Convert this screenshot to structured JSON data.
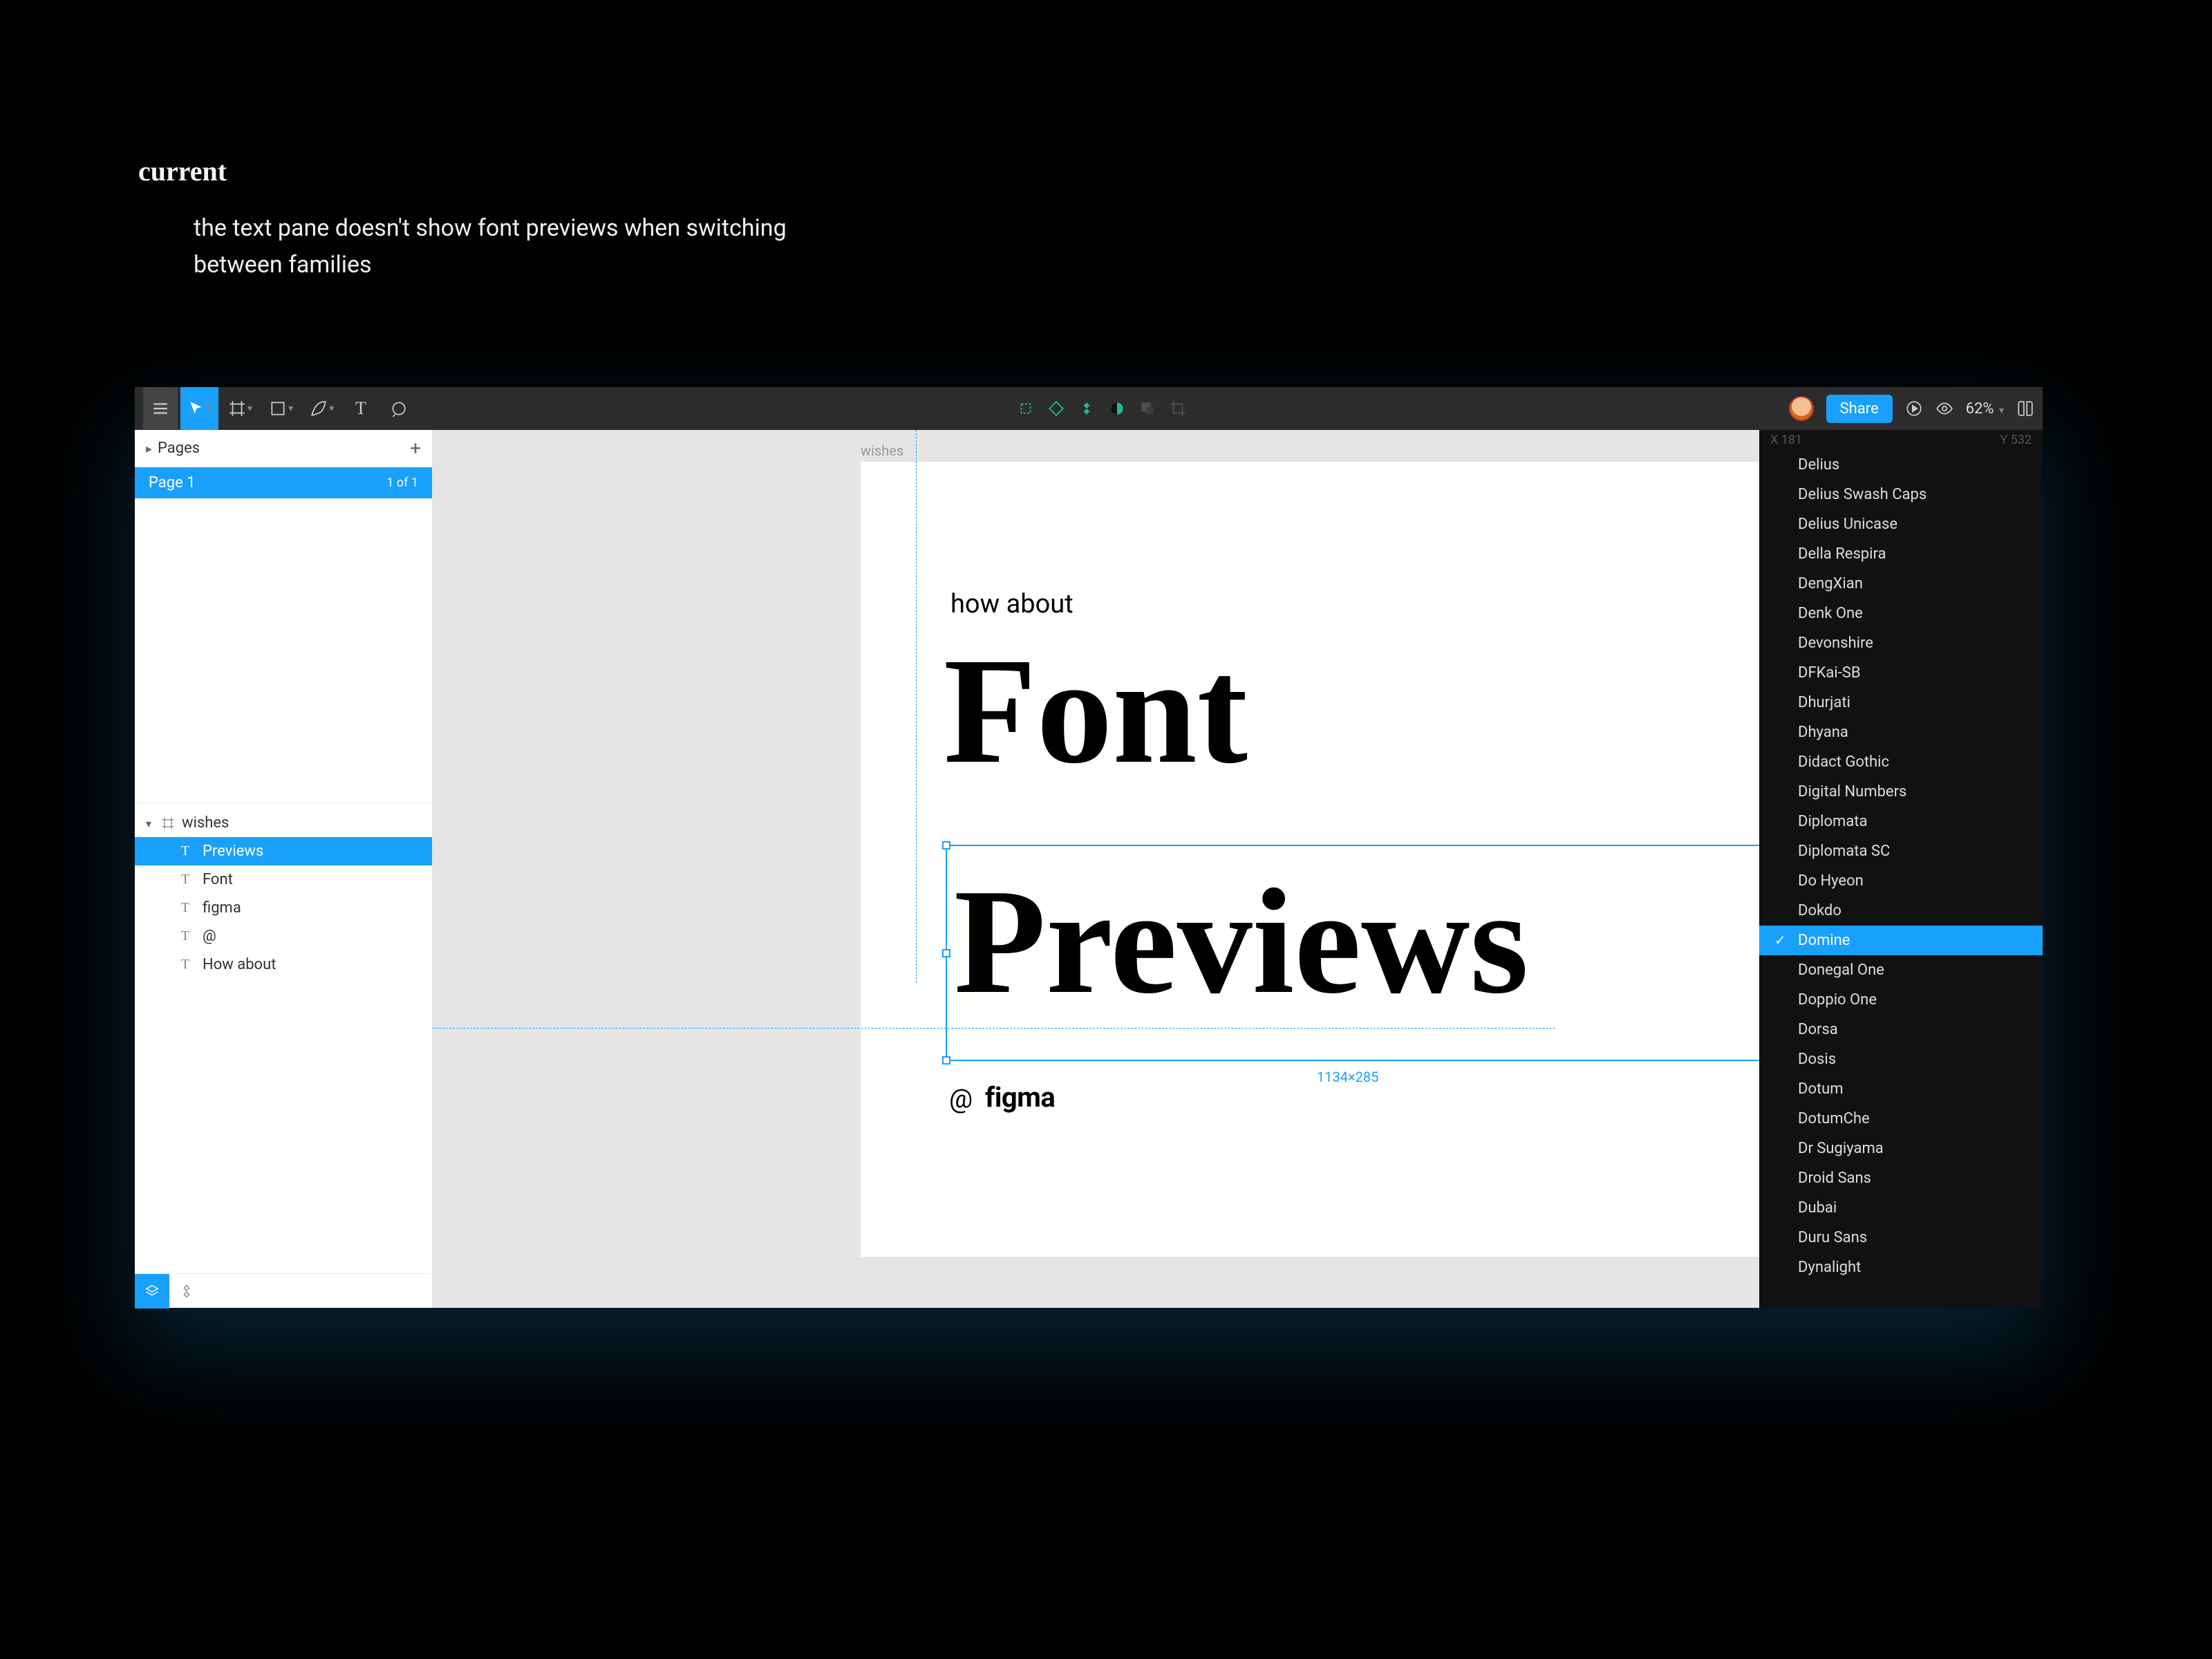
{
  "slide": {
    "title": "current",
    "description": "the text pane doesn't show font previews when switching between families"
  },
  "toolbar": {
    "share_label": "Share",
    "zoom_level": "62%"
  },
  "left_panel": {
    "pages_label": "Pages",
    "page_name": "Page 1",
    "page_count": "1 of 1",
    "root_frame": "wishes",
    "layers": [
      {
        "label": "Previews",
        "selected": true
      },
      {
        "label": "Font",
        "selected": false
      },
      {
        "label": "figma",
        "selected": false
      },
      {
        "label": "@",
        "selected": false
      },
      {
        "label": "How about",
        "selected": false
      }
    ]
  },
  "canvas": {
    "frame_label": "wishes",
    "text_howabout": "how about",
    "text_font": "Font",
    "text_previews": "Previews",
    "text_at": "@",
    "text_figma": "figma",
    "selection_dims": "1134×285"
  },
  "font_dropdown": {
    "hidden_top_left": "X 181",
    "hidden_top_right": "Y 532",
    "selected": "Domine",
    "fonts": [
      "Delius",
      "Delius Swash Caps",
      "Delius Unicase",
      "Della Respira",
      "DengXian",
      "Denk One",
      "Devonshire",
      "DFKai-SB",
      "Dhurjati",
      "Dhyana",
      "Didact Gothic",
      "Digital Numbers",
      "Diplomata",
      "Diplomata SC",
      "Do Hyeon",
      "Dokdo",
      "Domine",
      "Donegal One",
      "Doppio One",
      "Dorsa",
      "Dosis",
      "Dotum",
      "DotumChe",
      "Dr Sugiyama",
      "Droid Sans",
      "Dubai",
      "Duru Sans",
      "Dynalight"
    ]
  }
}
